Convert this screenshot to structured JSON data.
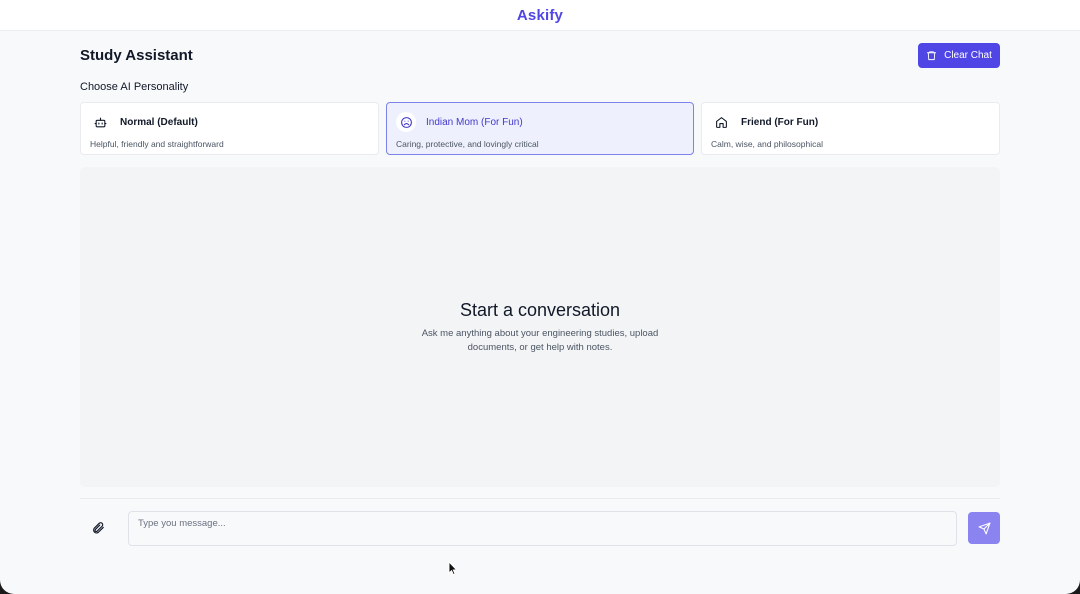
{
  "app": {
    "brand": "Askify"
  },
  "header": {
    "title": "Study Assistant",
    "clear_label": "Clear Chat"
  },
  "personality": {
    "section_label": "Choose AI Personality",
    "selected": "Indian Mom (For Fun)",
    "options": [
      {
        "name": "Normal (Default)",
        "description": "Helpful, friendly and straightforward",
        "icon": "robot-icon"
      },
      {
        "name": "Indian Mom (For Fun)",
        "description": "Caring, protective, and lovingly critical",
        "icon": "frown-face-icon"
      },
      {
        "name": "Friend (For Fun)",
        "description": "Calm, wise, and philosophical",
        "icon": "home-icon"
      }
    ]
  },
  "chat": {
    "empty_title": "Start a conversation",
    "empty_subtitle": "Ask me anything about your engineering studies, upload documents, or get help with notes."
  },
  "composer": {
    "placeholder": "Type you message...",
    "value": ""
  },
  "colors": {
    "accent": "#4f46e5",
    "send_button": "#8b84f0",
    "selected_card_bg": "#eef1fd"
  }
}
